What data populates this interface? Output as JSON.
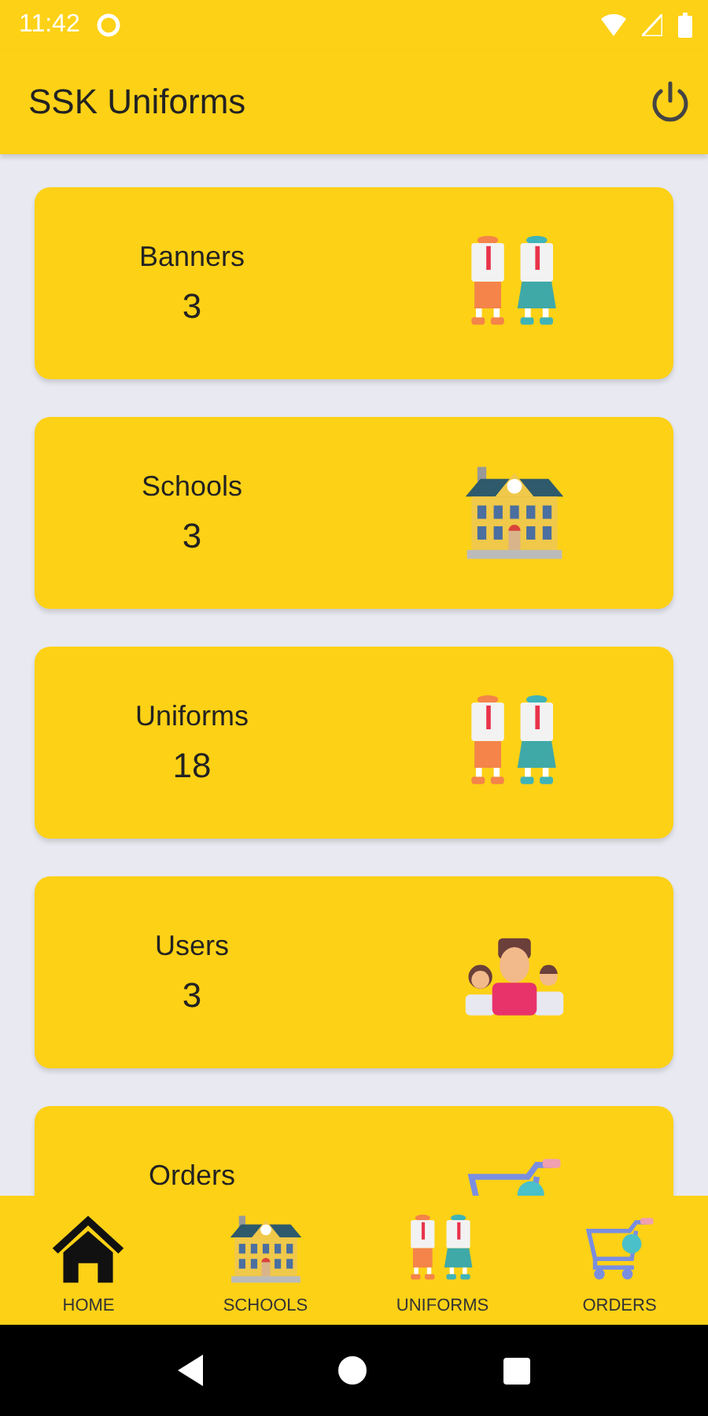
{
  "status_bar": {
    "time": "11:42"
  },
  "app_bar": {
    "title": "SSK Uniforms"
  },
  "cards": [
    {
      "label": "Banners",
      "count": "3",
      "kind": "uniforms"
    },
    {
      "label": "Schools",
      "count": "3",
      "kind": "school"
    },
    {
      "label": "Uniforms",
      "count": "18",
      "kind": "uniforms"
    },
    {
      "label": "Users",
      "count": "3",
      "kind": "users"
    },
    {
      "label": "Orders",
      "kind": "cart"
    }
  ],
  "bottom_nav": [
    {
      "label": "HOME",
      "kind": "home"
    },
    {
      "label": "SCHOOLS",
      "kind": "school"
    },
    {
      "label": "UNIFORMS",
      "kind": "uniforms"
    },
    {
      "label": "ORDERS",
      "kind": "cart"
    }
  ]
}
